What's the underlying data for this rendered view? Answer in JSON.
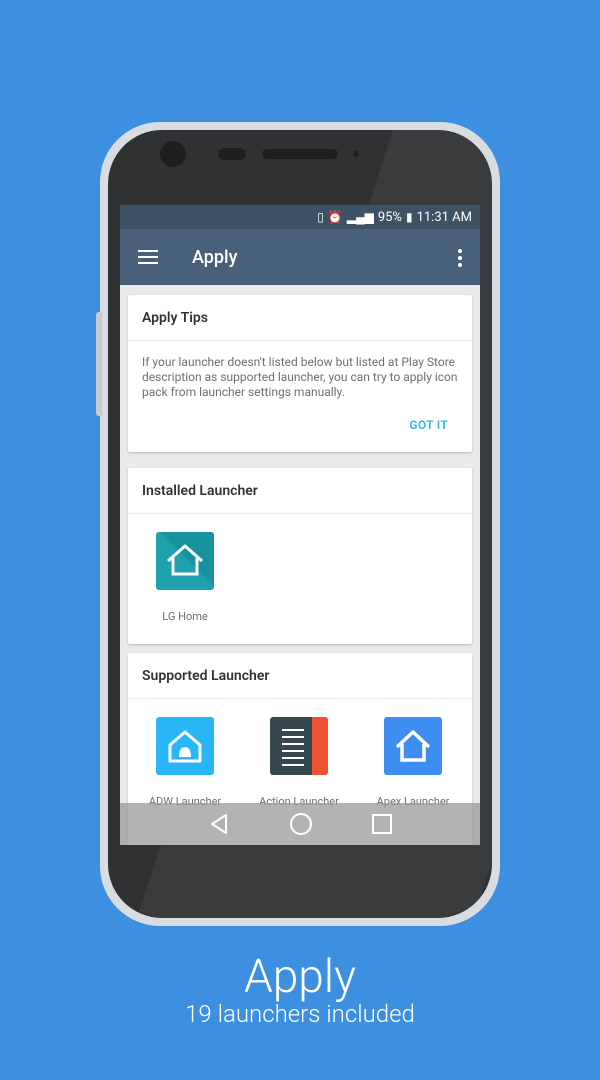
{
  "status_bar": {
    "battery": "95%",
    "time": "11:31 AM"
  },
  "app_bar": {
    "title": "Apply"
  },
  "tips_card": {
    "title": "Apply Tips",
    "body": "If your launcher doesn't listed below but listed at Play Store description as supported launcher, you can try to apply icon pack from launcher settings manually.",
    "action": "GOT IT"
  },
  "installed_card": {
    "title": "Installed Launcher",
    "launchers": [
      {
        "label": "LG Home",
        "icon": "lg-home-icon",
        "color": "#1da1ad"
      }
    ]
  },
  "supported_card": {
    "title": "Supported Launcher",
    "launchers": [
      {
        "label": "ADW Launcher",
        "icon": "adw-launcher-icon",
        "color": "#29b6f6"
      },
      {
        "label": "Action Launcher",
        "icon": "action-launcher-icon",
        "color": "#37474f"
      },
      {
        "label": "Apex Launcher",
        "icon": "apex-launcher-icon",
        "color": "#3d8ef0"
      }
    ]
  },
  "caption": {
    "title": "Apply",
    "subtitle": "19 launchers included"
  },
  "colors": {
    "background": "#3d8fe0",
    "app_bar": "#48607a",
    "accent": "#33b5e5"
  }
}
